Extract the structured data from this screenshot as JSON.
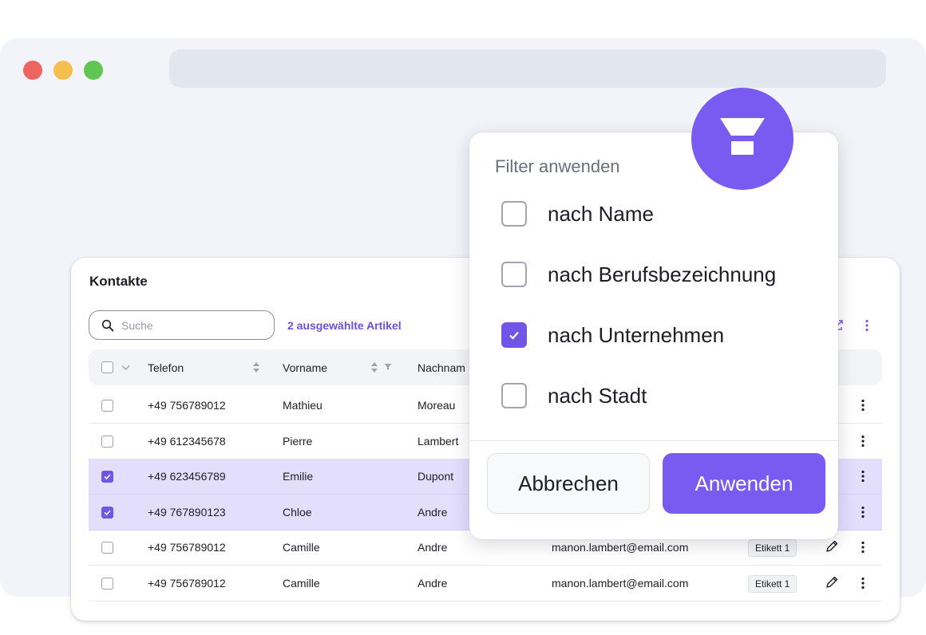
{
  "card": {
    "title": "Kontakte",
    "search_placeholder": "Suche",
    "selected_count": "2 ausgewählte Artikel",
    "columns": [
      "Telefon",
      "Vorname",
      "Nachnam"
    ],
    "rows": [
      {
        "phone": "+49 756789012",
        "first": "Mathieu",
        "last": "Moreau",
        "email": "",
        "tag": "",
        "selected": false
      },
      {
        "phone": "+49 612345678",
        "first": "Pierre",
        "last": "Lambert",
        "email": "",
        "tag": "",
        "selected": false
      },
      {
        "phone": "+49 623456789",
        "first": "Emilie",
        "last": "Dupont",
        "email": "",
        "tag": "",
        "selected": true
      },
      {
        "phone": "+49 767890123",
        "first": "Chloe",
        "last": "Andre",
        "email": "",
        "tag": "",
        "selected": true
      },
      {
        "phone": "+49 756789012",
        "first": "Camille",
        "last": "Andre",
        "email": "manon.lambert@email.com",
        "tag": "Etikett 1",
        "selected": false
      },
      {
        "phone": "+49 756789012",
        "first": "Camille",
        "last": "Andre",
        "email": "manon.lambert@email.com",
        "tag": "Etikett 1",
        "selected": false
      }
    ]
  },
  "filter": {
    "title": "Filter anwenden",
    "options": [
      {
        "label": "nach Name",
        "checked": false
      },
      {
        "label": "nach Berufsbezeichnung",
        "checked": false
      },
      {
        "label": "nach Unternehmen",
        "checked": true
      },
      {
        "label": "nach Stadt",
        "checked": false
      }
    ],
    "cancel_label": "Abbrechen",
    "apply_label": "Anwenden"
  },
  "icons": [
    "search-icon",
    "share-icon",
    "more-vertical-icon",
    "sort-icon",
    "filter-icon",
    "pencil-icon",
    "check-icon",
    "chevron-down-icon"
  ],
  "colors": {
    "accent": "#7a5bf2",
    "selected_row": "#e4defd",
    "browser_bg": "#f2f4f9"
  }
}
